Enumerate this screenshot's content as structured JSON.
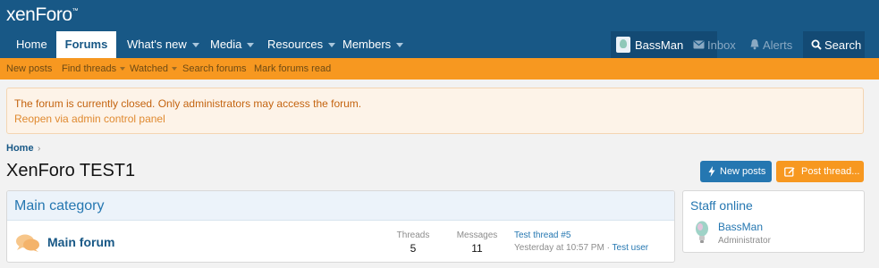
{
  "brand": {
    "logo_text": "xenForo",
    "logo_mark": "™"
  },
  "nav": {
    "tabs": [
      {
        "label": "Home"
      },
      {
        "label": "Forums"
      },
      {
        "label": "What's new"
      },
      {
        "label": "Media"
      },
      {
        "label": "Resources"
      },
      {
        "label": "Members"
      }
    ],
    "account_name": "BassMan",
    "inbox": "Inbox",
    "alerts": "Alerts",
    "search": "Search"
  },
  "subnav": [
    "New posts",
    "Find threads",
    "Watched",
    "Search forums",
    "Mark forums read"
  ],
  "notice": {
    "message": "The forum is currently closed. Only administrators may access the forum.",
    "link": "Reopen via admin control panel"
  },
  "breadcrumb": {
    "home": "Home",
    "separator": "›"
  },
  "page_title": "XenForo TEST1",
  "buttons": {
    "new_posts": "New posts",
    "post_thread": "Post thread..."
  },
  "category": {
    "title": "Main category",
    "forums": [
      {
        "name": "Main forum",
        "threads_label": "Threads",
        "threads": "5",
        "messages_label": "Messages",
        "messages": "11",
        "last_thread": "Test thread #5",
        "last_time": "Yesterday at 10:57 PM",
        "last_sep": "·",
        "last_user": "Test user"
      }
    ]
  },
  "sidebar": {
    "staff_title": "Staff online",
    "staff": [
      {
        "name": "BassMan",
        "role": "Administrator"
      }
    ]
  },
  "colors": {
    "header_blue": "#185886",
    "accent_orange": "#f79820",
    "link_blue": "#2577b1",
    "notice_bg": "#fdf3e8"
  }
}
